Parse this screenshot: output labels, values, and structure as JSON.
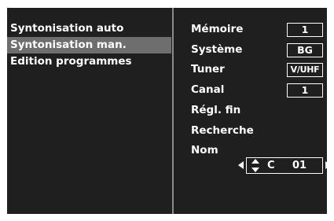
{
  "menu": {
    "items": [
      {
        "label": "Syntonisation auto",
        "selected": false
      },
      {
        "label": "Syntonisation man.",
        "selected": true
      },
      {
        "label": "Edition programmes",
        "selected": false
      }
    ]
  },
  "settings": {
    "memoire": {
      "label": "Mémoire",
      "value": "1"
    },
    "systeme": {
      "label": "Système",
      "value": "BG"
    },
    "tuner": {
      "label": "Tuner",
      "value": "V/UHF"
    },
    "canal": {
      "label": "Canal",
      "value": "1"
    },
    "regl_fin": {
      "label": "Régl. fin"
    },
    "recherche": {
      "label": "Recherche"
    },
    "nom": {
      "label": "Nom",
      "char": "C",
      "number": "01"
    }
  },
  "icons": {
    "nom_left": "triangle-left-icon",
    "nom_right": "triangle-right-icon",
    "nom_updown": "up-down-arrows-icon"
  },
  "colors": {
    "background": "#1f1f1f",
    "highlight": "#6e6e6e",
    "divider": "#8a8a8a",
    "text": "#ffffff"
  }
}
